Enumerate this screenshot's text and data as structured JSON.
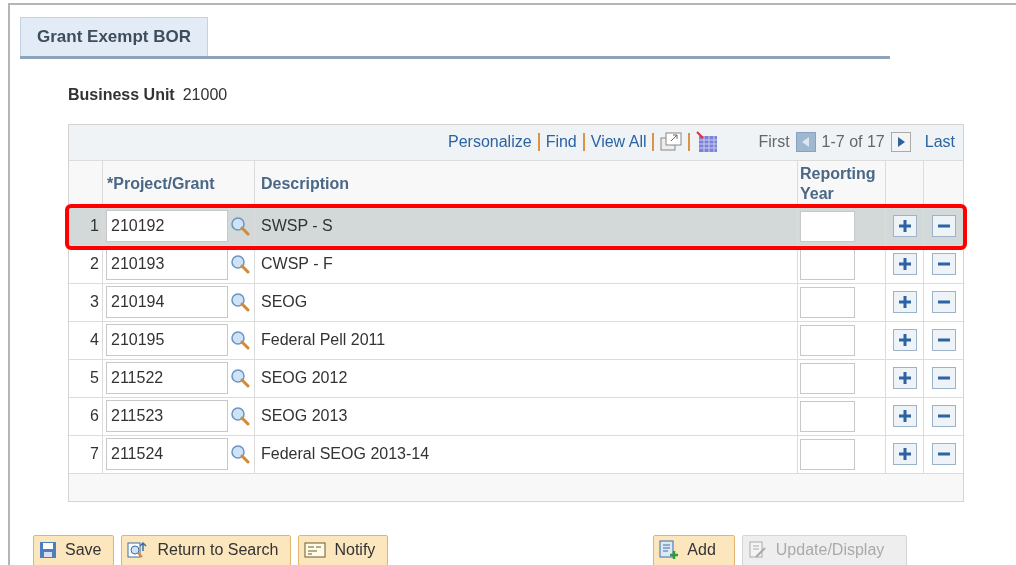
{
  "tab": {
    "label": "Grant Exempt BOR",
    "selected": true
  },
  "business_unit": {
    "label": "Business Unit",
    "value": "21000"
  },
  "grid": {
    "nav_links": [
      "Personalize",
      "Find",
      "View All"
    ],
    "pager": {
      "first": "First",
      "range": "1-7 of 17",
      "last": "Last"
    },
    "columns": [
      "*Project/Grant",
      "Description",
      "Reporting Year"
    ],
    "rows": [
      {
        "num": "1",
        "project": "210192",
        "description": "SWSP - S",
        "selected": true
      },
      {
        "num": "2",
        "project": "210193",
        "description": "CWSP - F",
        "selected": false
      },
      {
        "num": "3",
        "project": "210194",
        "description": "SEOG",
        "selected": false
      },
      {
        "num": "4",
        "project": "210195",
        "description": "Federal Pell 2011",
        "selected": false
      },
      {
        "num": "5",
        "project": "211522",
        "description": "SEOG 2012",
        "selected": false
      },
      {
        "num": "6",
        "project": "211523",
        "description": "SEOG 2013",
        "selected": false
      },
      {
        "num": "7",
        "project": "211524",
        "description": "Federal SEOG 2013-14",
        "selected": false
      }
    ]
  },
  "buttons": [
    {
      "label": "Save",
      "kind": "save",
      "disabled": false
    },
    {
      "label": "Return to Search",
      "kind": "return",
      "disabled": false
    },
    {
      "label": "Notify",
      "kind": "notify",
      "disabled": false
    },
    {
      "label": "Add",
      "kind": "add",
      "disabled": false
    },
    {
      "label": "Update/Display",
      "kind": "update",
      "disabled": true
    }
  ]
}
